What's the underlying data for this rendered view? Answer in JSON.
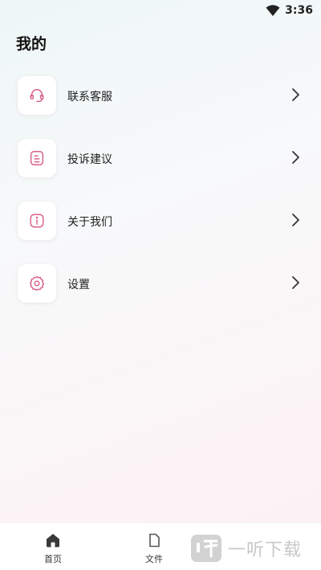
{
  "status_bar": {
    "time": "3:36",
    "wifi_icon": "wifi-icon"
  },
  "page": {
    "title": "我的"
  },
  "menu": {
    "items": [
      {
        "label": "联系客服",
        "icon": "headset-icon"
      },
      {
        "label": "投诉建议",
        "icon": "document-icon"
      },
      {
        "label": "关于我们",
        "icon": "info-icon"
      },
      {
        "label": "设置",
        "icon": "gear-icon"
      }
    ]
  },
  "bottom_nav": {
    "items": [
      {
        "label": "首页",
        "icon": "home-icon"
      },
      {
        "label": "文件",
        "icon": "file-icon"
      }
    ]
  },
  "watermark": {
    "text": "一听下载"
  },
  "colors": {
    "accent": "#d9628a",
    "icon_bg": "#ffffff"
  }
}
